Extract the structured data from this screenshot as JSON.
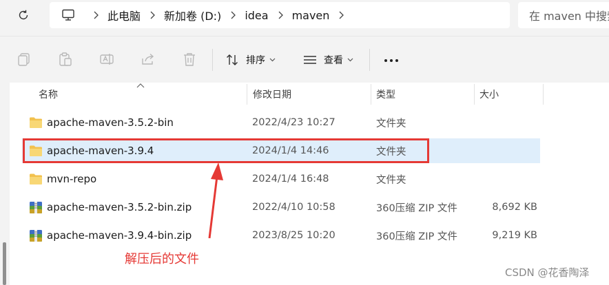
{
  "address_bar": {
    "breadcrumb": [
      "此电脑",
      "新加卷 (D:)",
      "idea",
      "maven"
    ],
    "search_placeholder": "在 maven 中搜索"
  },
  "toolbar": {
    "sort_label": "排序",
    "view_label": "查看"
  },
  "columns": {
    "name": "名称",
    "date": "修改日期",
    "type": "类型",
    "size": "大小"
  },
  "files": [
    {
      "name": "apache-maven-3.5.2-bin",
      "date": "2022/4/23 10:27",
      "type": "文件夹",
      "size": "",
      "icon": "folder-icon",
      "selected": false
    },
    {
      "name": "apache-maven-3.9.4",
      "date": "2024/1/4 14:46",
      "type": "文件夹",
      "size": "",
      "icon": "folder-icon",
      "selected": true
    },
    {
      "name": "mvn-repo",
      "date": "2024/1/4 16:48",
      "type": "文件夹",
      "size": "",
      "icon": "folder-icon",
      "selected": false
    },
    {
      "name": "apache-maven-3.5.2-bin.zip",
      "date": "2022/4/10 10:58",
      "type": "360压缩 ZIP 文件",
      "size": "8,692 KB",
      "icon": "zip-archive-icon",
      "selected": false
    },
    {
      "name": "apache-maven-3.9.4-bin.zip",
      "date": "2023/8/25 10:20",
      "type": "360压缩 ZIP 文件",
      "size": "9,219 KB",
      "icon": "zip-archive-icon",
      "selected": false
    }
  ],
  "annotation": {
    "text": "解压后的文件",
    "color": "#e53935"
  },
  "watermark": "CSDN @花香陶泽",
  "colors": {
    "selection": "#dfeefb",
    "folder": "#f2c14e",
    "annotation": "#e53935"
  }
}
